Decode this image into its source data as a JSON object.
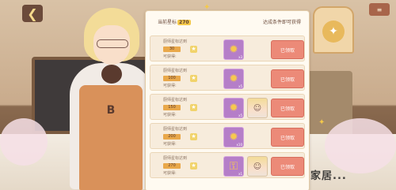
{
  "header": {
    "star_label": "当前星标",
    "star_value": "270",
    "condition_label": "达成条件即可获得"
  },
  "rows": [
    {
      "label": "厨师星标达到",
      "value": "30",
      "get_label": "可获得:",
      "reward_icon": "medal-icon",
      "qty": "x3",
      "portrait": false,
      "claim_label": "已领取"
    },
    {
      "label": "厨师星标达到",
      "value": "100",
      "get_label": "可获得:",
      "reward_icon": "medal-icon",
      "qty": "x5",
      "portrait": false,
      "claim_label": "已领取"
    },
    {
      "label": "厨师星标达到",
      "value": "150",
      "get_label": "可获得:",
      "reward_icon": "medal-icon",
      "qty": "x5",
      "portrait": true,
      "claim_label": "已领取"
    },
    {
      "label": "厨师星标达到",
      "value": "200",
      "get_label": "可获得:",
      "reward_icon": "medal-icon",
      "qty": "x10",
      "portrait": false,
      "claim_label": "已领取"
    },
    {
      "label": "厨师星标达到",
      "value": "270",
      "get_label": "可获得:",
      "reward_icon": "key-icon",
      "qty": "x1",
      "portrait": true,
      "claim_label": "已领取"
    }
  ],
  "colors": {
    "panel_bg": "#fffaf1",
    "claim_button": "#ec8a78",
    "reward_frame": "#b57ec8",
    "star_highlight": "#f4c94a"
  },
  "watermark": "家居..."
}
